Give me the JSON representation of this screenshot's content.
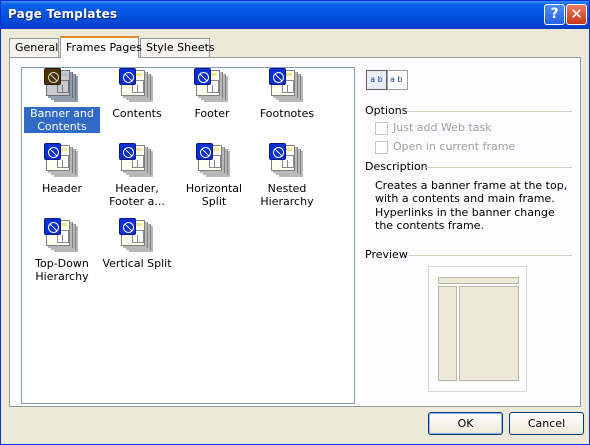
{
  "window": {
    "title": "Page Templates"
  },
  "title_buttons": {
    "help": "?",
    "close": "✕"
  },
  "tabs": [
    {
      "label": "General"
    },
    {
      "label": "Frames Pages"
    },
    {
      "label": "Style Sheets"
    }
  ],
  "templates": [
    {
      "label": "Banner and Contents",
      "selected": true
    },
    {
      "label": "Contents"
    },
    {
      "label": "Footer"
    },
    {
      "label": "Footnotes"
    },
    {
      "label": "Header"
    },
    {
      "label": "Header, Footer a..."
    },
    {
      "label": "Horizontal Split"
    },
    {
      "label": "Nested Hierarchy"
    },
    {
      "label": "Top-Down Hierarchy"
    },
    {
      "label": "Vertical Split"
    }
  ],
  "view": {
    "large_icons": "a b",
    "list": "a b "
  },
  "options": {
    "heading": "Options",
    "just_add_web_task": "Just add Web task",
    "open_in_current_frame": "Open in current frame"
  },
  "description": {
    "heading": "Description",
    "text": "Creates a banner frame at the top, with a contents and main frame. Hyperlinks in the banner change the contents frame."
  },
  "preview": {
    "heading": "Preview"
  },
  "buttons": {
    "ok": "OK",
    "cancel": "Cancel"
  },
  "colors": {
    "title_bar": "#0453e0",
    "selection": "#316ac5",
    "dialog_bg": "#ece9d8"
  }
}
